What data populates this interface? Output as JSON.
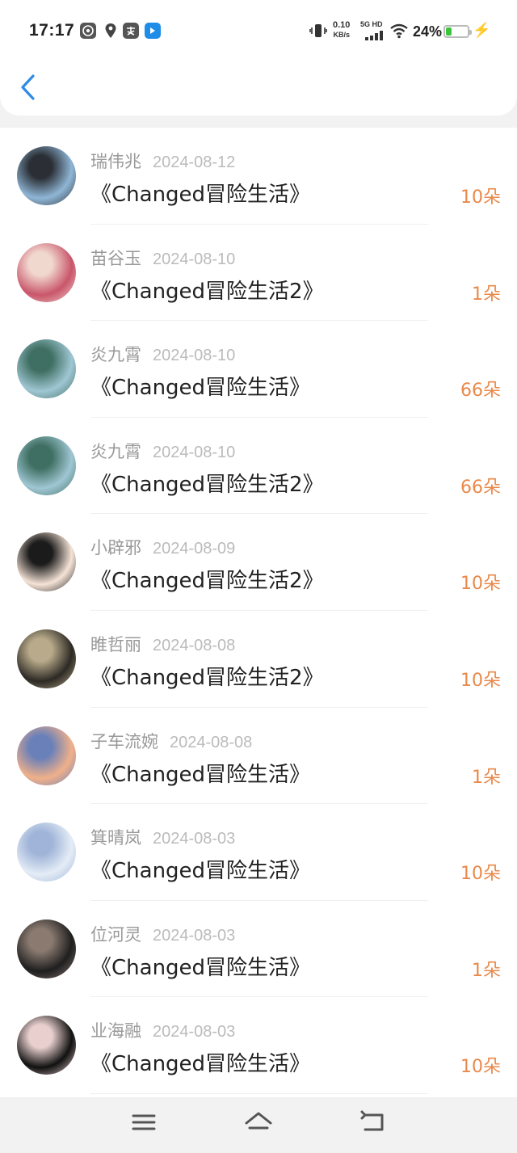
{
  "status_bar": {
    "time": "17:17",
    "net_speed_value": "0.10",
    "net_speed_unit": "KB/s",
    "net_type": "5G HD",
    "battery_percent": "24%",
    "battery_level": 0.24,
    "app_icons": [
      "weibo-icon",
      "location-pin-icon",
      "alipay-icon",
      "blue-app-icon"
    ]
  },
  "header": {
    "back_icon": "chevron-left-icon"
  },
  "gift_records": [
    {
      "name": "瑞伟兆",
      "date": "2024-08-12",
      "title": "《Changed冒险生活》",
      "amount": "10朵",
      "avatar_colors": [
        "#8fb6d6",
        "#2b2f35"
      ]
    },
    {
      "name": "苗谷玉",
      "date": "2024-08-10",
      "title": "《Changed冒险生活2》",
      "amount": "1朵",
      "avatar_colors": [
        "#c9566a",
        "#f1d8cf"
      ]
    },
    {
      "name": "炎九霄",
      "date": "2024-08-10",
      "title": "《Changed冒险生活》",
      "amount": "66朵",
      "avatar_colors": [
        "#9fc6d3",
        "#3f6f62"
      ]
    },
    {
      "name": "炎九霄",
      "date": "2024-08-10",
      "title": "《Changed冒险生活2》",
      "amount": "66朵",
      "avatar_colors": [
        "#9fc6d3",
        "#3f6f62"
      ]
    },
    {
      "name": "小辟邪",
      "date": "2024-08-09",
      "title": "《Changed冒险生活2》",
      "amount": "10朵",
      "avatar_colors": [
        "#f5e3d6",
        "#1b1b1b"
      ]
    },
    {
      "name": "睢哲丽",
      "date": "2024-08-08",
      "title": "《Changed冒险生活2》",
      "amount": "10朵",
      "avatar_colors": [
        "#2d2a25",
        "#b8aa8a"
      ]
    },
    {
      "name": "子车流婉",
      "date": "2024-08-08",
      "title": "《Changed冒险生活》",
      "amount": "1朵",
      "avatar_colors": [
        "#f0b08a",
        "#6a80b8"
      ]
    },
    {
      "name": "箕晴岚",
      "date": "2024-08-03",
      "title": "《Changed冒险生活》",
      "amount": "10朵",
      "avatar_colors": [
        "#e4ecf6",
        "#9fb4d8"
      ]
    },
    {
      "name": "位河灵",
      "date": "2024-08-03",
      "title": "《Changed冒险生活》",
      "amount": "1朵",
      "avatar_colors": [
        "#1f1f1f",
        "#8a7a70"
      ]
    },
    {
      "name": "业海融",
      "date": "2024-08-03",
      "title": "《Changed冒险生活》",
      "amount": "10朵",
      "avatar_colors": [
        "#111111",
        "#e9d0cf"
      ]
    }
  ],
  "bottom_nav": {
    "icons": [
      "menu-icon",
      "home-icon",
      "back-icon"
    ]
  },
  "colors": {
    "amount": "#e9894a",
    "accent": "#2e8be6"
  }
}
